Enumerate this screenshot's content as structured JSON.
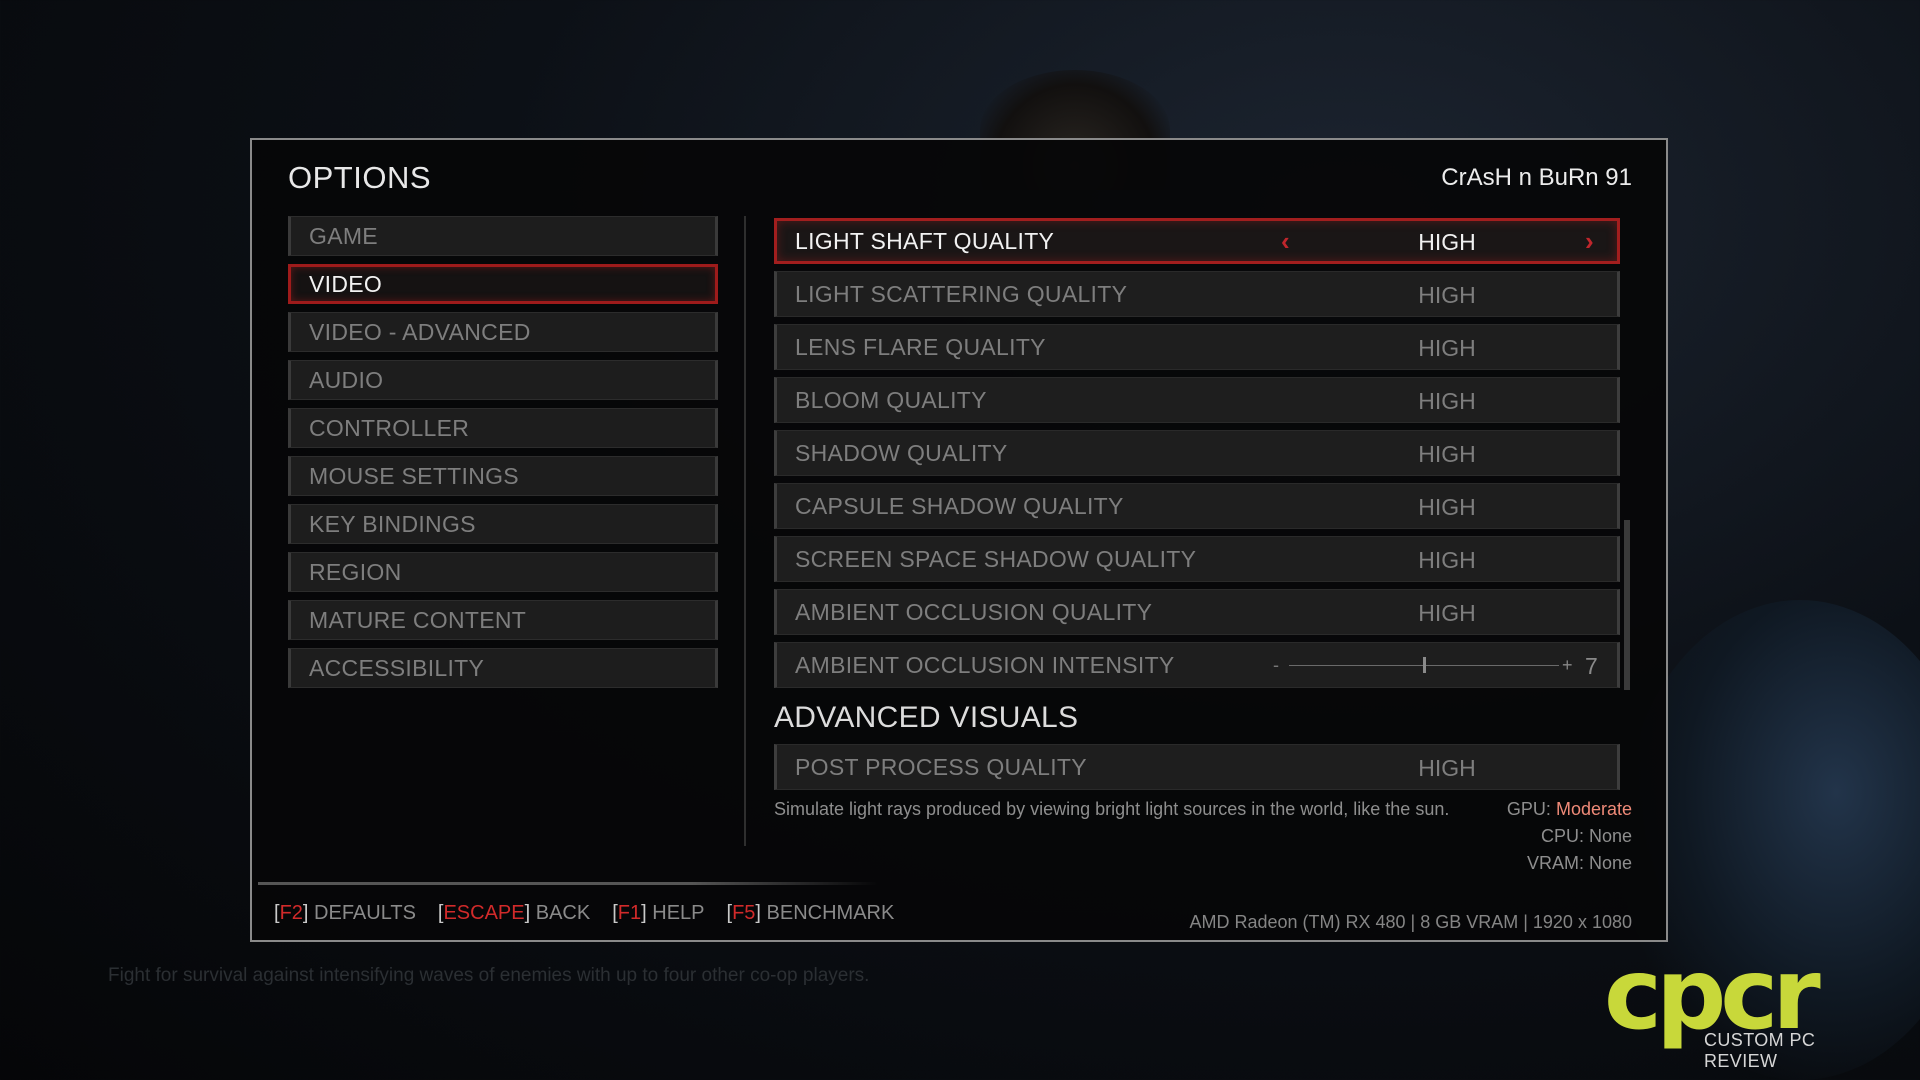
{
  "title": "OPTIONS",
  "username": "CrAsH n BuRn 91",
  "nav": [
    {
      "label": "GAME",
      "active": false
    },
    {
      "label": "VIDEO",
      "active": true
    },
    {
      "label": "VIDEO - ADVANCED",
      "active": false
    },
    {
      "label": "AUDIO",
      "active": false
    },
    {
      "label": "CONTROLLER",
      "active": false
    },
    {
      "label": "MOUSE SETTINGS",
      "active": false
    },
    {
      "label": "KEY BINDINGS",
      "active": false
    },
    {
      "label": "REGION",
      "active": false
    },
    {
      "label": "MATURE CONTENT",
      "active": false
    },
    {
      "label": "ACCESSIBILITY",
      "active": false
    }
  ],
  "settings": [
    {
      "label": "LIGHT SHAFT QUALITY",
      "value": "HIGH",
      "active": true
    },
    {
      "label": "LIGHT SCATTERING QUALITY",
      "value": "HIGH"
    },
    {
      "label": "LENS FLARE QUALITY",
      "value": "HIGH"
    },
    {
      "label": "BLOOM QUALITY",
      "value": "HIGH"
    },
    {
      "label": "SHADOW QUALITY",
      "value": "HIGH"
    },
    {
      "label": "CAPSULE SHADOW QUALITY",
      "value": "HIGH"
    },
    {
      "label": "SCREEN SPACE SHADOW QUALITY",
      "value": "HIGH"
    },
    {
      "label": "AMBIENT OCCLUSION QUALITY",
      "value": "HIGH"
    }
  ],
  "slider": {
    "label": "AMBIENT OCCLUSION INTENSITY",
    "minus": "-",
    "plus": "+",
    "value": "7",
    "level": 0.5
  },
  "section_heading": "ADVANCED VISUALS",
  "section_settings": [
    {
      "label": "POST PROCESS QUALITY",
      "value": "HIGH"
    }
  ],
  "description": "Simulate light rays produced by viewing bright light sources in the world, like the sun.",
  "impact": {
    "gpu_label": "GPU:",
    "gpu_value": "Moderate",
    "cpu": "CPU: None",
    "vram": "VRAM: None",
    "gpu_color": "#ef8a78"
  },
  "footer_hints": [
    {
      "key": "F2",
      "label": "DEFAULTS"
    },
    {
      "key": "ESCAPE",
      "label": "BACK"
    },
    {
      "key": "F1",
      "label": "HELP"
    },
    {
      "key": "F5",
      "label": "BENCHMARK"
    }
  ],
  "hardware": "AMD Radeon (TM) RX 480 | 8 GB VRAM | 1920 x 1080",
  "background_text": "Fight for survival against intensifying waves of enemies with up to four other co-op players.",
  "watermark": {
    "letters": "cpcr",
    "tagline": "CUSTOM PC REVIEW",
    "color": "#c8d83a"
  },
  "colors": {
    "accent": "#a21e1e",
    "key_red": "#d12a2a"
  }
}
